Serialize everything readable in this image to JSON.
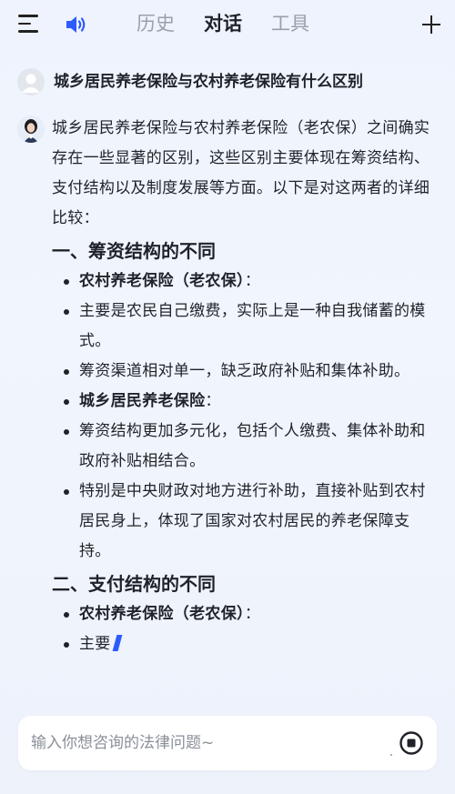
{
  "header": {
    "tabs": [
      "历史",
      "对话",
      "工具"
    ],
    "active_tab": 1
  },
  "question": {
    "text": "城乡居民养老保险与农村养老保险有什么区别"
  },
  "answer": {
    "intro": "城乡居民养老保险与农村养老保险（老农保）之间确实存在一些显著的区别，这些区别主要体现在筹资结构、支付结构以及制度发展等方面。以下是对这两者的详细比较：",
    "section1": {
      "heading": "一、筹资结构的不同",
      "items": [
        {
          "bold": "农村养老保险（老农保）",
          "suffix": "："
        },
        {
          "text": "主要是农民自己缴费，实际上是一种自我储蓄的模式。"
        },
        {
          "text": "筹资渠道相对单一，缺乏政府补贴和集体补助。"
        },
        {
          "bold": "城乡居民养老保险",
          "suffix": "："
        },
        {
          "text": "筹资结构更加多元化，包括个人缴费、集体补助和政府补贴相结合。"
        },
        {
          "text": "特别是中央财政对地方进行补助，直接补贴到农村居民身上，体现了国家对农村居民的养老保障支持。"
        }
      ]
    },
    "section2": {
      "heading": "二、支付结构的不同",
      "items": [
        {
          "bold": "农村养老保险（老农保）",
          "suffix": "："
        },
        {
          "text": "主要"
        }
      ]
    }
  },
  "input": {
    "placeholder": "输入你想咨询的法律问题~"
  },
  "colors": {
    "accent": "#2e5bff",
    "text": "#1f2329",
    "muted_tab": "#9aa0a8"
  },
  "icons": [
    "menu-icon",
    "speaker-icon",
    "plus-icon",
    "user-avatar",
    "ai-avatar",
    "stop-icon"
  ]
}
